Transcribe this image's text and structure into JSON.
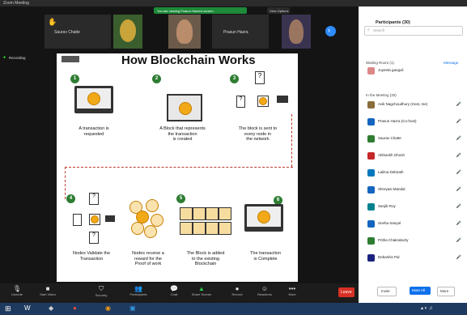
{
  "window": {
    "title": "Zoom Meeting"
  },
  "banner": {
    "text": "You are viewing Prasun Hazra's screen"
  },
  "view_options": {
    "label": "View Options"
  },
  "participants_top": [
    {
      "name": "Saurav Chatte",
      "label": ""
    },
    {
      "name": "",
      "label": ""
    },
    {
      "name": "",
      "label": ""
    },
    {
      "name": "Prasun Hazra",
      "label": ""
    },
    {
      "name": "",
      "label": ""
    }
  ],
  "recording": {
    "label": "Recording"
  },
  "slide": {
    "title": "How Blockchain Works",
    "steps": [
      {
        "num": "1",
        "caption": "A transaction is\nrequested"
      },
      {
        "num": "2",
        "caption": "A Block that represents\nthe transaction\nis created"
      },
      {
        "num": "3",
        "caption": "The block is sent to\nevery node in\nthe network"
      },
      {
        "num": "4",
        "caption": "Nodes Validate the\nTransaction"
      },
      {
        "num": "",
        "caption": "Nodes receive a\nreward for the\nProof of work"
      },
      {
        "num": "5",
        "caption": "The Block is added\nto the existing\nBlockchain"
      },
      {
        "num": "6",
        "caption": "The transaction\nis Complete"
      }
    ]
  },
  "toolbar": [
    {
      "label": "Unmute",
      "icon": "microphone-icon"
    },
    {
      "label": "Start Video",
      "icon": "camera-icon"
    },
    {
      "label": "Security",
      "icon": "shield-icon"
    },
    {
      "label": "Participants",
      "icon": "people-icon"
    },
    {
      "label": "Chat",
      "icon": "chat-icon"
    },
    {
      "label": "Share Screen",
      "icon": "share-icon"
    },
    {
      "label": "Record",
      "icon": "record-icon"
    },
    {
      "label": "Reactions",
      "icon": "reaction-icon"
    },
    {
      "label": "More",
      "icon": "more-icon"
    }
  ],
  "leave": {
    "label": "Leave"
  },
  "panel": {
    "title": "Participants (30)",
    "search_placeholder": "Search",
    "waiting_header": "Waiting Room (1)",
    "waiting_action": "Message",
    "in_meeting_header": "In the Meeting (30)",
    "waiting_people": [
      {
        "name": "Joyeeta ganguli"
      }
    ],
    "people": [
      {
        "name": "Avik Nagchoudhury (Host, me)",
        "color": "#8a6d3b"
      },
      {
        "name": "Prasun Hazra (Co-host)",
        "color": "#1565c0"
      },
      {
        "name": "Saurav Chatte",
        "color": "#2e7d32"
      },
      {
        "name": "Abhisekh Ghosh",
        "color": "#c62828"
      },
      {
        "name": "Lalima Debnath",
        "color": "#0277bd"
      },
      {
        "name": "Shreyasi Mandal",
        "color": "#1565c0"
      },
      {
        "name": "Sanjib Roy",
        "color": "#00838f"
      },
      {
        "name": "Sneha Sanyal",
        "color": "#1565c0"
      },
      {
        "name": "Pritha Chakraborty",
        "color": "#2e7d32"
      },
      {
        "name": "Debashis Pal",
        "color": "#1a237e"
      }
    ],
    "invite_label": "Invite",
    "mute_all_label": "Mute All",
    "more_label": "More"
  }
}
